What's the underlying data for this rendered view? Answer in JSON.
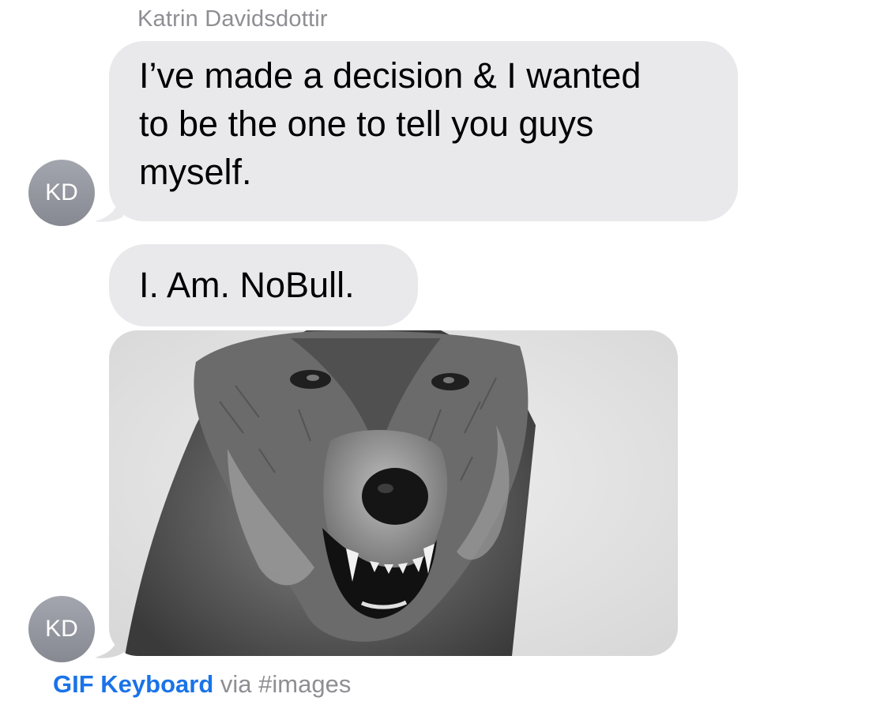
{
  "thread": {
    "sender_name": "Katrin Davidsdottir",
    "avatar_initials": "KD"
  },
  "messages": [
    {
      "type": "text",
      "lines": [
        "I’ve made a decision & I wanted",
        "to be the one to tell you guys",
        "myself."
      ]
    },
    {
      "type": "text",
      "text": "I. Am. NoBull."
    },
    {
      "type": "gif",
      "icon": "wolf-gif-icon"
    }
  ],
  "attribution": {
    "app_name": "GIF Keyboard",
    "via_text": "via",
    "source": "#images"
  },
  "colors": {
    "bubble": "#e9e9eb",
    "avatar": "#8e9199",
    "secondary_text": "#8e8e93",
    "link": "#1a73e8"
  }
}
